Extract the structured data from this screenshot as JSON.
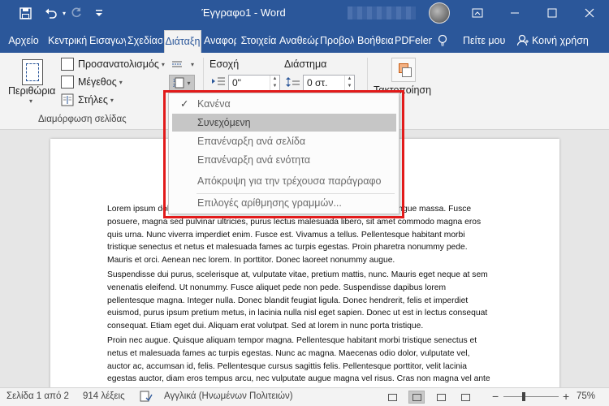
{
  "titlebar": {
    "title": "Έγγραφο1 - Word",
    "save_icon": "save-icon",
    "undo_icon": "undo-icon",
    "redo_icon": "redo-icon",
    "customize_icon": "customize-quick-access-icon",
    "ribbon_options_icon": "ribbon-display-options-icon",
    "minimize_icon": "minimize-icon",
    "maximize_icon": "maximize-icon",
    "close_icon": "close-icon",
    "colors": {
      "brand": "#2b579a"
    }
  },
  "tabs": [
    {
      "label": "Αρχείο"
    },
    {
      "label": "Κεντρική"
    },
    {
      "label": "Εισαγωγή"
    },
    {
      "label": "Σχεδίαση"
    },
    {
      "label": "Διάταξη",
      "active": true
    },
    {
      "label": "Αναφορές"
    },
    {
      "label": "Στοιχεία"
    },
    {
      "label": "Αναθεώρηση"
    },
    {
      "label": "Προβολή"
    },
    {
      "label": "Βοήθεια"
    },
    {
      "label": "PDFelement"
    }
  ],
  "tell_me": "Πείτε μου",
  "share": "Κοινή χρήση",
  "ribbon": {
    "margins": "Περιθώρια",
    "orientation": "Προσανατολισμός",
    "size": "Μέγεθος",
    "columns": "Στήλες",
    "group_label": "Διαμόρφωση σελίδας",
    "indent": {
      "label": "Εσοχή",
      "left_value": "0\""
    },
    "spacing": {
      "label": "Διάστημα",
      "before_value": "0 στ."
    },
    "arrange": "Τακτοποίηση"
  },
  "menu": {
    "items": [
      {
        "label": "Κανένα",
        "checked": true
      },
      {
        "label": "Συνεχόμενη",
        "highlighted": true
      },
      {
        "label": "Επανέναρξη ανά σελίδα"
      },
      {
        "label": "Επανέναρξη ανά ενότητα"
      },
      {
        "label": "Απόκρυψη για την τρέχουσα παράγραφο"
      },
      {
        "label": "Επιλογές αρίθμησης γραμμών..."
      }
    ],
    "highlight_color": "#e21b1b"
  },
  "document": {
    "paragraphs": [
      "Lorem ipsum dolor sit amet, consectetuer adipiscing elit. Maecenas porttitor congue massa. Fusce posuere, magna sed pulvinar ultricies, purus lectus malesuada libero, sit amet commodo magna eros quis urna. Nunc viverra imperdiet enim. Fusce est. Vivamus a tellus. Pellentesque habitant morbi tristique senectus et netus et malesuada fames ac turpis egestas. Proin pharetra nonummy pede. Mauris et orci. Aenean nec lorem. In porttitor. Donec laoreet nonummy augue.",
      "Suspendisse dui purus, scelerisque at, vulputate vitae, pretium mattis, nunc. Mauris eget neque at sem venenatis eleifend. Ut nonummy. Fusce aliquet pede non pede. Suspendisse dapibus lorem pellentesque magna. Integer nulla. Donec blandit feugiat ligula. Donec hendrerit, felis et imperdiet euismod, purus ipsum pretium metus, in lacinia nulla nisl eget sapien. Donec ut est in lectus consequat consequat. Etiam eget dui. Aliquam erat volutpat. Sed at lorem in nunc porta tristique.",
      "Proin nec augue. Quisque aliquam tempor magna. Pellentesque habitant morbi tristique senectus et netus et malesuada fames ac turpis egestas. Nunc ac magna. Maecenas odio dolor, vulputate vel, auctor ac, accumsan id, felis. Pellentesque cursus sagittis felis. Pellentesque porttitor, velit lacinia egestas auctor, diam eros tempus arcu, nec vulputate augue magna vel risus. Cras non magna vel ante adipiscing rhoncus. Vivamus a mi. Morbi neque. Aliquam erat volutpat. Integer ultrices lobortis eros."
    ]
  },
  "statusbar": {
    "page": "Σελίδα 1 από 2",
    "words": "914 λέξεις",
    "language": "Αγγλικά (Ηνωμένων Πολιτειών)",
    "zoom": "75%",
    "zoom_minus": "−",
    "zoom_plus": "+"
  }
}
